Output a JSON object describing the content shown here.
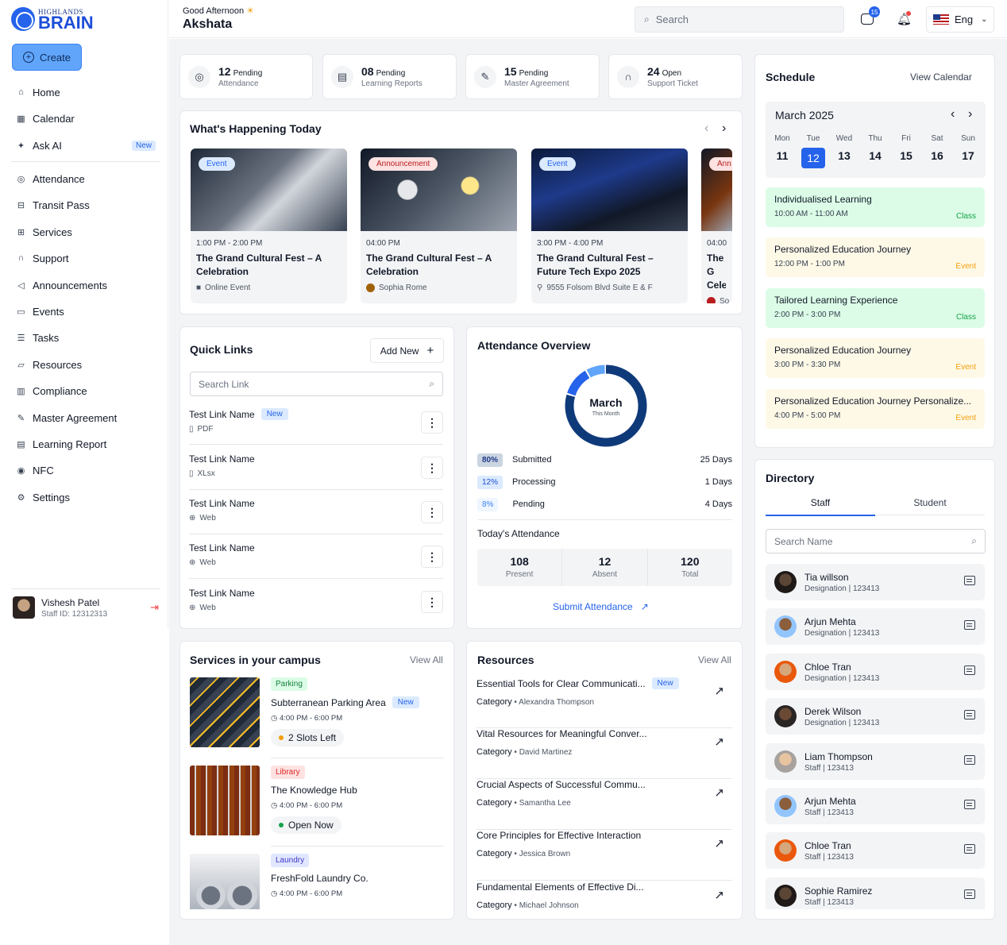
{
  "brand": {
    "line1": "HIGHLANDS",
    "line2": "BRAIN"
  },
  "sidebar": {
    "create_label": "Create",
    "items": [
      {
        "label": "Home",
        "icon": "home-icon"
      },
      {
        "label": "Calendar",
        "icon": "calendar-icon"
      },
      {
        "label": "Ask AI",
        "icon": "sparkle-icon",
        "badge": "New"
      },
      {
        "label": "Attendance",
        "icon": "attendance-icon"
      },
      {
        "label": "Transit Pass",
        "icon": "bus-icon"
      },
      {
        "label": "Services",
        "icon": "map-icon"
      },
      {
        "label": "Support",
        "icon": "headset-icon"
      },
      {
        "label": "Announcements",
        "icon": "megaphone-icon"
      },
      {
        "label": "Events",
        "icon": "event-icon"
      },
      {
        "label": "Tasks",
        "icon": "tasks-icon"
      },
      {
        "label": "Resources",
        "icon": "folder-icon"
      },
      {
        "label": "Compliance",
        "icon": "chart-icon"
      },
      {
        "label": "Master Agreement",
        "icon": "signature-icon"
      },
      {
        "label": "Learning Report",
        "icon": "report-icon"
      },
      {
        "label": "NFC",
        "icon": "nfc-icon"
      },
      {
        "label": "Settings",
        "icon": "settings-icon"
      }
    ],
    "user": {
      "name": "Vishesh Patel",
      "id": "Staff ID: 12312313"
    }
  },
  "header": {
    "greeting": "Good Afternoon",
    "name": "Akshata",
    "search_placeholder": "Search",
    "chat_count": "15",
    "language": "Eng"
  },
  "stats": [
    {
      "num": "12",
      "word": "Pending",
      "label": "Attendance"
    },
    {
      "num": "08",
      "word": "Pending",
      "label": "Learning Reports"
    },
    {
      "num": "15",
      "word": "Pending",
      "label": "Master Agreement"
    },
    {
      "num": "24",
      "word": "Open",
      "label": "Support Ticket"
    }
  ],
  "happening": {
    "title": "What's Happening Today",
    "cards": [
      {
        "tag": "Event",
        "time": "1:00 PM - 2:00 PM",
        "title": "The Grand Cultural Fest – A Celebration",
        "meta": "Online Event"
      },
      {
        "tag": "Announcement",
        "time": "04:00 PM",
        "title": "The Grand Cultural Fest – A Celebration",
        "meta": "Sophia Rome"
      },
      {
        "tag": "Event",
        "time": "3:00 PM - 4:00 PM",
        "title": "The Grand Cultural Fest – Future Tech Expo 2025",
        "meta": "9555 Folsom Blvd Suite E & F"
      },
      {
        "tag": "Ann",
        "time": "04:00",
        "title": "The G Celeb",
        "meta": "So"
      }
    ]
  },
  "quick_links": {
    "title": "Quick Links",
    "add_label": "Add New",
    "search_placeholder": "Search Link",
    "items": [
      {
        "name": "Test Link Name",
        "type": "PDF",
        "badge": "New"
      },
      {
        "name": "Test Link Name",
        "type": "XLsx"
      },
      {
        "name": "Test Link Name",
        "type": "Web"
      },
      {
        "name": "Test Link Name",
        "type": "Web"
      },
      {
        "name": "Test Link Name",
        "type": "Web"
      }
    ]
  },
  "attendance": {
    "title": "Attendance Overview",
    "center_title": "March",
    "center_sub": "This Month",
    "rows": [
      {
        "pct": "80%",
        "label": "Submitted",
        "days": "25 Days"
      },
      {
        "pct": "12%",
        "label": "Processing",
        "days": "1 Days"
      },
      {
        "pct": "8%",
        "label": "Pending",
        "days": "4 Days"
      }
    ],
    "donut": [
      0.8,
      0.12,
      0.08
    ],
    "today_label": "Today's Attendance",
    "today": [
      {
        "num": "108",
        "label": "Present"
      },
      {
        "num": "12",
        "label": "Absent"
      },
      {
        "num": "120",
        "label": "Total"
      }
    ],
    "submit_label": "Submit Attendance"
  },
  "services": {
    "title": "Services in your campus",
    "view_all": "View All",
    "items": [
      {
        "tag": "Parking",
        "name": "Subterranean Parking Area",
        "badge": "New",
        "time": "4:00 PM - 6:00 PM",
        "status": "2 Slots Left"
      },
      {
        "tag": "Library",
        "name": "The Knowledge Hub",
        "time": "4:00 PM - 6:00 PM",
        "status": "Open Now"
      },
      {
        "tag": "Laundry",
        "name": "FreshFold Laundry Co.",
        "time": "4:00 PM - 6:00 PM"
      }
    ]
  },
  "resources": {
    "title": "Resources",
    "view_all": "View All",
    "category_label": "Category",
    "items": [
      {
        "title": "Essential Tools for Clear Communicati...",
        "badge": "New",
        "author": "Alexandra Thompson"
      },
      {
        "title": "Vital Resources for Meaningful Conver...",
        "author": "David Martinez"
      },
      {
        "title": "Crucial Aspects of Successful Commu...",
        "author": "Samantha Lee"
      },
      {
        "title": "Core Principles for Effective Interaction",
        "author": "Jessica Brown"
      },
      {
        "title": "Fundamental Elements of Effective Di...",
        "author": "Michael Johnson"
      }
    ]
  },
  "schedule": {
    "title": "Schedule",
    "view_calendar": "View Calendar",
    "month": "March 2025",
    "days": [
      {
        "d": "Mon",
        "n": "11"
      },
      {
        "d": "Tue",
        "n": "12"
      },
      {
        "d": "Wed",
        "n": "13"
      },
      {
        "d": "Thu",
        "n": "14"
      },
      {
        "d": "Fri",
        "n": "15"
      },
      {
        "d": "Sat",
        "n": "16"
      },
      {
        "d": "Sun",
        "n": "17"
      }
    ],
    "items": [
      {
        "title": "Individualised Learning",
        "time": "10:00 AM - 11:00 AM",
        "kind": "Class"
      },
      {
        "title": "Personalized Education Journey",
        "time": "12:00 PM - 1:00 PM",
        "kind": "Event"
      },
      {
        "title": "Tailored Learning Experience",
        "time": "2:00 PM - 3:00 PM",
        "kind": "Class"
      },
      {
        "title": "Personalized Education Journey",
        "time": "3:00 PM - 3:30 PM",
        "kind": "Event"
      },
      {
        "title": "Personalized Education Journey Personalize...",
        "time": "4:00 PM - 5:00 PM",
        "kind": "Event"
      }
    ]
  },
  "directory": {
    "title": "Directory",
    "tabs": [
      "Staff",
      "Student"
    ],
    "search_placeholder": "Search Name",
    "people": [
      {
        "name": "Tia willson",
        "desc": "Designation | 123413"
      },
      {
        "name": "Arjun Mehta",
        "desc": "Designation | 123413"
      },
      {
        "name": "Chloe Tran",
        "desc": "Designation | 123413"
      },
      {
        "name": "Derek Wilson",
        "desc": "Designation | 123413"
      },
      {
        "name": "Liam Thompson",
        "desc": "Staff | 123413"
      },
      {
        "name": "Arjun Mehta",
        "desc": "Staff | 123413"
      },
      {
        "name": "Chloe Tran",
        "desc": "Staff | 123413"
      },
      {
        "name": "Sophie Ramirez",
        "desc": "Staff | 123413"
      }
    ]
  },
  "colors": {
    "accent": "#2563eb",
    "donut_main": "#0f3a7a",
    "donut_mid": "#2563eb",
    "donut_light": "#60a5fa",
    "class": "#16a34a",
    "event": "#f59e0b"
  }
}
